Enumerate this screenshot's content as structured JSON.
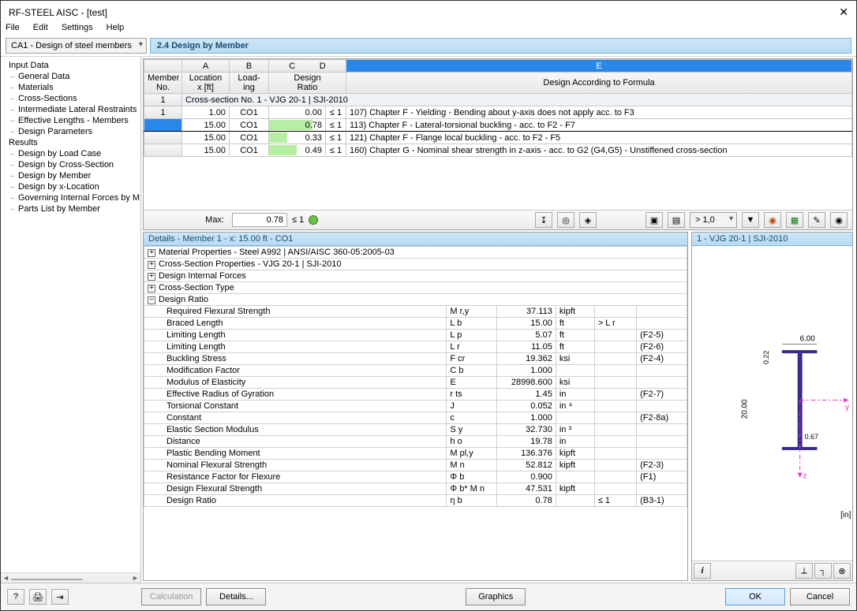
{
  "window": {
    "title": "RF-STEEL AISC - [test]",
    "close": "✕"
  },
  "menu": [
    "File",
    "Edit",
    "Settings",
    "Help"
  ],
  "combo": "CA1 - Design of steel members",
  "section_title": "2.4 Design by Member",
  "sidebar": {
    "groups": [
      {
        "label": "Input Data",
        "items": [
          "General Data",
          "Materials",
          "Cross-Sections",
          "Intermediate Lateral Restraints",
          "Effective Lengths - Members",
          "Design Parameters"
        ]
      },
      {
        "label": "Results",
        "items": [
          "Design by Load Case",
          "Design by Cross-Section",
          "Design by Member",
          "Design by x-Location",
          "Governing Internal Forces by M",
          "Parts List by Member"
        ]
      }
    ]
  },
  "grid": {
    "cols_letters": [
      "A",
      "B",
      "C",
      "D",
      "E"
    ],
    "head1": {
      "member": "Member\nNo.",
      "location": "Location\nx [ft]",
      "loading": "Load-\ning",
      "design_ratio": "Design\nRatio",
      "formula": "Design According to Formula"
    },
    "section_row": "Cross-section No.  1 - VJG 20-1 | SJI-2010",
    "rows": [
      {
        "hdr": "1",
        "loc": "1.00",
        "loading": "CO1",
        "ratio": "0.00",
        "ratio_w": 0,
        "leq": "≤ 1",
        "desc": "107) Chapter F - Yielding - Bending about y-axis does not apply acc. to F3"
      },
      {
        "hdr": "",
        "loc": "15.00",
        "loading": "CO1",
        "ratio": "0.78",
        "ratio_w": 78,
        "leq": "≤ 1",
        "desc": "113) Chapter F - Lateral-torsional buckling - acc. to F2 - F7",
        "sel": true,
        "hl": true
      },
      {
        "hdr": "",
        "loc": "15.00",
        "loading": "CO1",
        "ratio": "0.33",
        "ratio_w": 33,
        "leq": "≤ 1",
        "desc": "121) Chapter F - Flange local buckling - acc. to F2 - F5"
      },
      {
        "hdr": "",
        "loc": "15.00",
        "loading": "CO1",
        "ratio": "0.49",
        "ratio_w": 49,
        "leq": "≤ 1",
        "desc": "160) Chapter G - Nominal shear strength in z-axis - acc. to G2 (G4,G5) - Unstiffened cross-section"
      }
    ],
    "max_label": "Max:",
    "max_value": "0.78",
    "max_leq": "≤ 1",
    "filter_combo": "> 1,0"
  },
  "details": {
    "title": "Details - Member 1 - x: 15.00 ft - CO1",
    "collapsed": [
      "Material Properties - Steel A992 | ANSI/AISC 360-05:2005-03",
      "Cross-Section Properties  - VJG 20-1 | SJI-2010",
      "Design Internal Forces",
      "Cross-Section Type"
    ],
    "expanded_label": "Design Ratio",
    "rows": [
      {
        "name": "Required Flexural Strength",
        "sym": "M r,y",
        "val": "37.113",
        "unit": "kipft",
        "cmp": "",
        "ref": ""
      },
      {
        "name": "Braced Length",
        "sym": "L b",
        "val": "15.00",
        "unit": "ft",
        "cmp": "> L r",
        "ref": ""
      },
      {
        "name": "Limiting Length",
        "sym": "L p",
        "val": "5.07",
        "unit": "ft",
        "cmp": "",
        "ref": "(F2-5)"
      },
      {
        "name": "Limiting Length",
        "sym": "L r",
        "val": "11.05",
        "unit": "ft",
        "cmp": "",
        "ref": "(F2-6)"
      },
      {
        "name": "Buckling Stress",
        "sym": "F cr",
        "val": "19.362",
        "unit": "ksi",
        "cmp": "",
        "ref": "(F2-4)"
      },
      {
        "name": "Modification Factor",
        "sym": "C b",
        "val": "1.000",
        "unit": "",
        "cmp": "",
        "ref": ""
      },
      {
        "name": "Modulus of Elasticity",
        "sym": "E",
        "val": "28998.600",
        "unit": "ksi",
        "cmp": "",
        "ref": ""
      },
      {
        "name": "Effective Radius of Gyration",
        "sym": "r ts",
        "val": "1.45",
        "unit": "in",
        "cmp": "",
        "ref": "(F2-7)"
      },
      {
        "name": "Torsional Constant",
        "sym": "J",
        "val": "0.052",
        "unit": "in ⁴",
        "cmp": "",
        "ref": ""
      },
      {
        "name": "Constant",
        "sym": "c",
        "val": "1.000",
        "unit": "",
        "cmp": "",
        "ref": "(F2-8a)"
      },
      {
        "name": "Elastic Section Modulus",
        "sym": "S y",
        "val": "32.730",
        "unit": "in ³",
        "cmp": "",
        "ref": ""
      },
      {
        "name": "Distance",
        "sym": "h o",
        "val": "19.78",
        "unit": "in",
        "cmp": "",
        "ref": ""
      },
      {
        "name": "Plastic Bending Moment",
        "sym": "M pl,y",
        "val": "136.376",
        "unit": "kipft",
        "cmp": "",
        "ref": ""
      },
      {
        "name": "Nominal Flexural Strength",
        "sym": "M n",
        "val": "52.812",
        "unit": "kipft",
        "cmp": "",
        "ref": "(F2-3)"
      },
      {
        "name": "Resistance Factor for Flexure",
        "sym": "Φ b",
        "val": "0.900",
        "unit": "",
        "cmp": "",
        "ref": "(F1)"
      },
      {
        "name": "Design Flexural Strength",
        "sym": "Φ b* M n",
        "val": "47.531",
        "unit": "kipft",
        "cmp": "",
        "ref": ""
      },
      {
        "name": "Design Ratio",
        "sym": "η b",
        "val": "0.78",
        "unit": "",
        "cmp": "≤ 1",
        "ref": "(B3-1)"
      }
    ]
  },
  "xs": {
    "title": "1 - VJG 20-1 | SJI-2010",
    "unit": "[in]",
    "dims": {
      "width": "6.00",
      "height": "20.00",
      "tf": "0.22",
      "tw": "0.67"
    },
    "axes": {
      "y": "y",
      "z": "z"
    }
  },
  "buttons": {
    "calc": "Calculation",
    "details": "Details...",
    "graphics": "Graphics",
    "ok": "OK",
    "cancel": "Cancel"
  }
}
